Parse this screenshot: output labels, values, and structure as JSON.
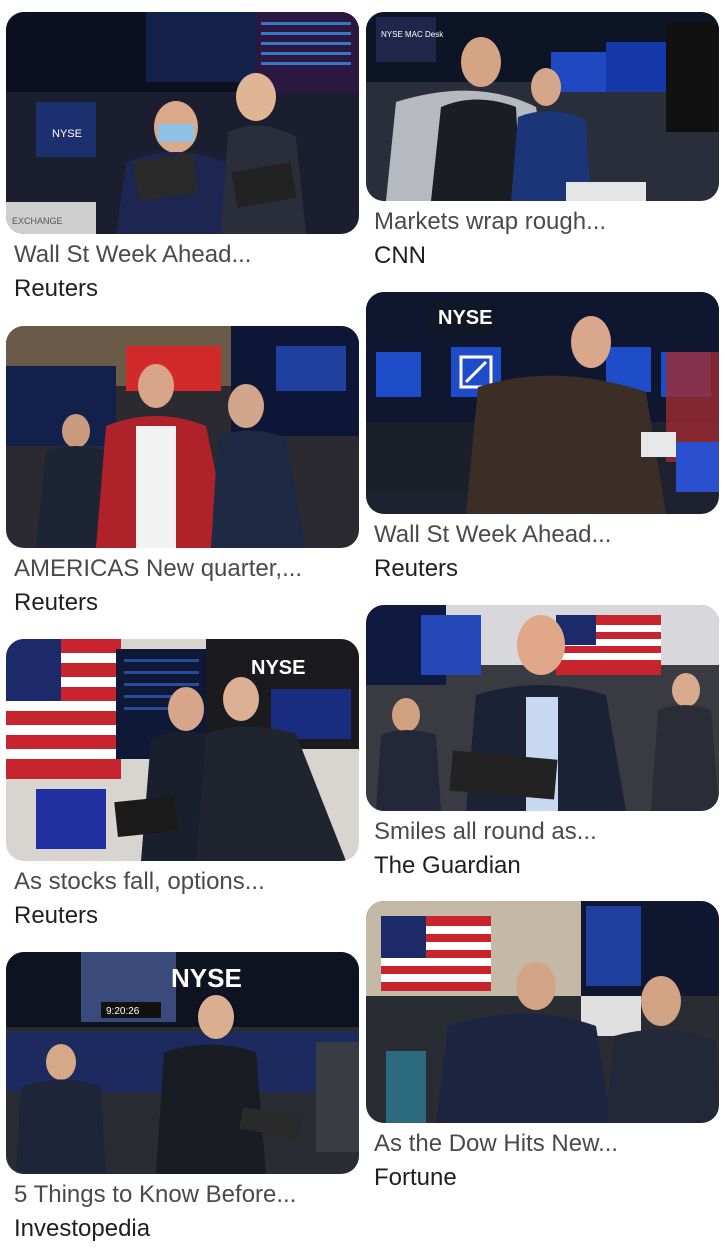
{
  "results": {
    "left": [
      {
        "title": "Wall St Week Ahead...",
        "source": "Reuters",
        "image": "traders-tablets-nyse-floor"
      },
      {
        "title": "AMERICAS New quarter,...",
        "source": "Reuters",
        "image": "trader-red-jacket-floor"
      },
      {
        "title": "As stocks fall, options...",
        "source": "Reuters",
        "image": "traders-flag-nyse-screen"
      },
      {
        "title": "5 Things to Know Before...",
        "source": "Investopedia",
        "image": "traders-nyse-sign-floor"
      }
    ],
    "right": [
      {
        "title": "Markets wrap rough...",
        "source": "CNN",
        "image": "trader-vest-tablet"
      },
      {
        "title": "Wall St Week Ahead...",
        "source": "Reuters",
        "image": "trader-nyse-deutsche-bank-screens"
      },
      {
        "title": "Smiles all round as...",
        "source": "The Guardian",
        "image": "smiling-trader-flag"
      },
      {
        "title": "As the Dow Hits New...",
        "source": "Fortune",
        "image": "traders-pointing-flag"
      }
    ]
  },
  "photo_text": {
    "nyse": "NYSE",
    "mac_desk": "NYSE MAC Desk",
    "exchange": "EXCHANGE",
    "clock": "9:20:26"
  }
}
